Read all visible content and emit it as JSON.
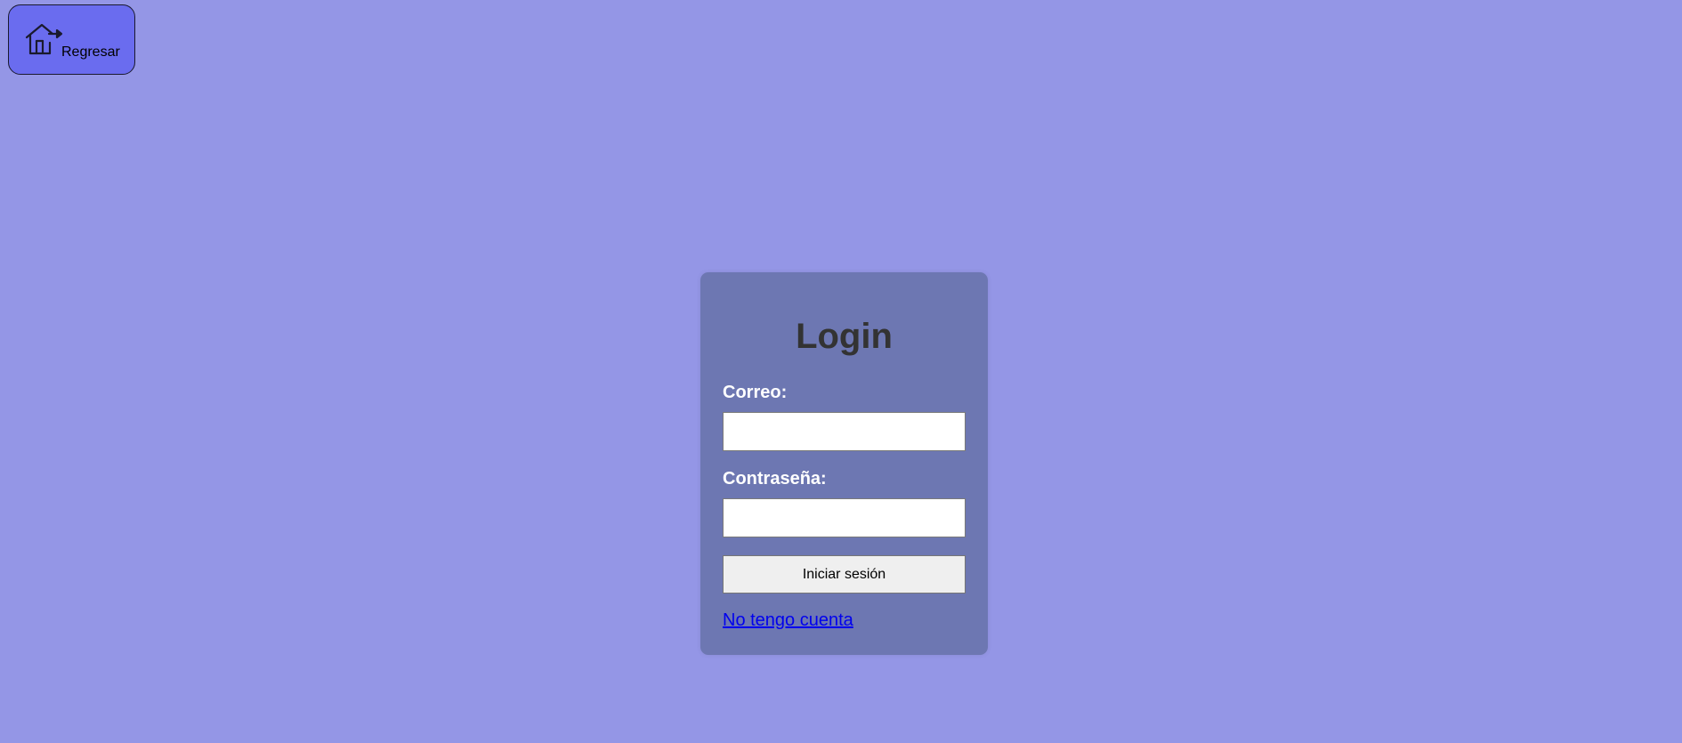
{
  "back_button": {
    "label": "Regresar",
    "icon": "home-arrow-icon"
  },
  "login": {
    "title": "Login",
    "email_label": "Correo:",
    "email_value": "",
    "password_label": "Contraseña:",
    "password_value": "",
    "submit_label": "Iniciar sesión",
    "signup_link": "No tengo cuenta"
  },
  "colors": {
    "background": "#9496e6",
    "back_button": "#6a6cef",
    "card": "#6d77b2",
    "title": "#333333",
    "label": "#ffffff",
    "link": "#0000ee"
  }
}
